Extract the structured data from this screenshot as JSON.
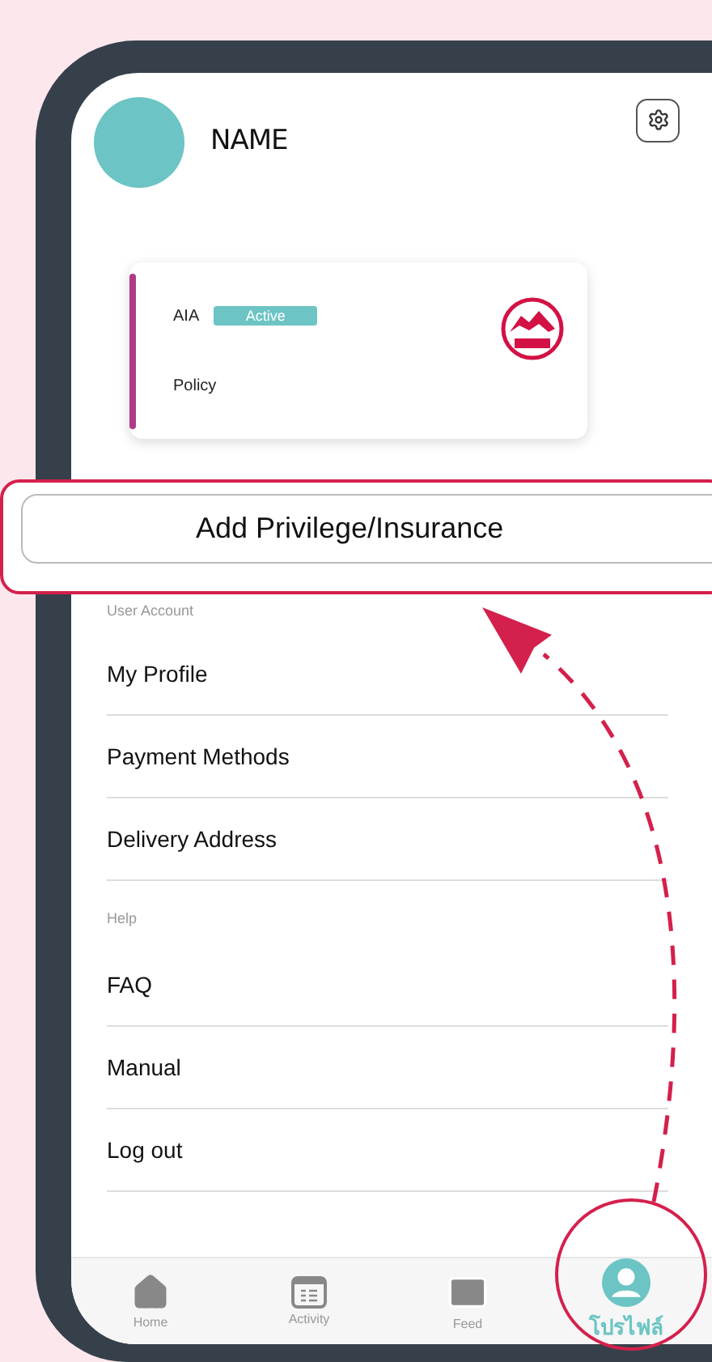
{
  "profile": {
    "name": "NAME"
  },
  "policy_card": {
    "provider": "AIA",
    "status": "Active",
    "label": "Policy"
  },
  "add_button": {
    "label": "Add Privilege/Insurance"
  },
  "sections": [
    {
      "title": "User Account",
      "items": [
        "My Profile",
        "Payment Methods",
        "Delivery Address"
      ]
    },
    {
      "title": "Help",
      "items": [
        "FAQ",
        "Manual",
        "Log out"
      ]
    }
  ],
  "tab_bar": [
    {
      "label": "Home",
      "kind": "home",
      "selected": false
    },
    {
      "label": "Activity",
      "kind": "activity",
      "selected": false
    },
    {
      "label": "Feed",
      "kind": "feed",
      "selected": false
    },
    {
      "label": "โปรไฟล์",
      "kind": "profile",
      "selected": true
    }
  ]
}
